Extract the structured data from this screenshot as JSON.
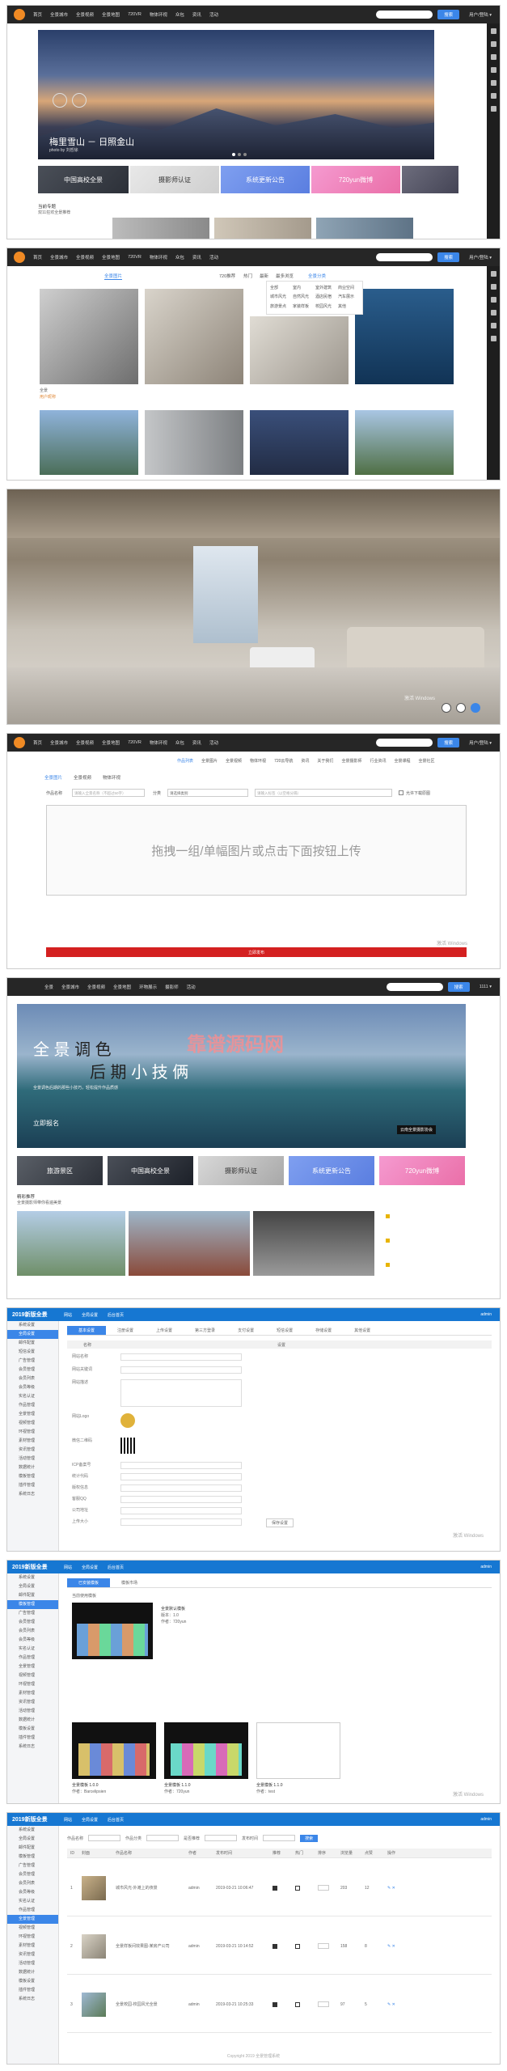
{
  "brand": {
    "accent": "#3b86e8",
    "logo_color": "#f08a24",
    "admin_blue": "#1677d2",
    "submit_red": "#d42020"
  },
  "nav": {
    "items": [
      "首页",
      "全景城市",
      "全景视频",
      "全景地图",
      "720VR",
      "物体环视",
      "众包",
      "资讯",
      "活动"
    ],
    "search_button": "搜索",
    "user": "用户/登陆 ▾"
  },
  "hero": {
    "title": "梅里雪山 － 日照金山",
    "credit": "photo by 刘哲徐",
    "tiles": [
      "中国高校全景",
      "摄影师认证",
      "系统更新公告",
      "720yun微博"
    ],
    "caption_title": "当前专题",
    "caption_sub": "双11狂欢全景推荐"
  },
  "gallery": {
    "tab_selected": "全景图片",
    "menu_title": "全景分类",
    "filters": [
      "720推荐",
      "热门",
      "最新",
      "最多浏览"
    ],
    "menu_items": [
      "全部",
      "室内",
      "室外建筑",
      "商业空间",
      "城市风光",
      "自然风光",
      "酒店民宿",
      "汽车展示",
      "旅游景点",
      "家装样板",
      "校园风光",
      "其他"
    ],
    "item1_label": "全景",
    "item1_author": "用户昵称"
  },
  "upload": {
    "tabs": [
      "全景图片",
      "全景视频",
      "物体环视"
    ],
    "top_tabs": [
      "作品列表",
      "全景图片",
      "全景视频",
      "物体环视",
      "720云导航",
      "资讯",
      "关于我们",
      "全景摄影师",
      "行业资讯",
      "全景课程",
      "全景社区"
    ],
    "label_title": "作品名称",
    "title_placeholder": "请输入全景名称（不超过50字）",
    "label_category": "分类",
    "category_value": "请选择类别",
    "tag_placeholder": "请输入标签（以空格分隔）",
    "checkbox_label": "允许下载原图",
    "drop_text": "拖拽一组/单幅图片或点击下面按钮上传",
    "submit": "立即发布",
    "watermark": "激活 Windows"
  },
  "portal": {
    "nav": [
      "全景",
      "全景城市",
      "全景视频",
      "全景地图",
      "环物展示",
      "摄影师",
      "活动"
    ],
    "search_button": "搜索",
    "user": "1111 ▾",
    "banner_line1_a": "全 景",
    "banner_line1_b": "调 色",
    "banner_line2_a": "后 期",
    "banner_line2_b": "小 技 俩",
    "banner_sub": "全景调色后期的那些小技巧，轻松提升作品质感",
    "banner_watermark": "靠谱源码网",
    "banner_register": "立即报名",
    "banner_brand": "云南全景摄影协会",
    "tiles": [
      "旅游景区",
      "中国高校全景",
      "摄影师认证",
      "系统更新公告",
      "720yun微博"
    ],
    "section_title": "精彩推荐",
    "section_sub": "全景摄影师带你看遍美景"
  },
  "admin1": {
    "title": "2019新版全景",
    "header_links": [
      "网站",
      "全局设置",
      "后台首页"
    ],
    "user": "admin",
    "sidebar": [
      "系统设置",
      "全局设置",
      "邮件配置",
      "短信设置",
      "广告管理",
      "会员管理",
      "会员列表",
      "会员等级",
      "实名认证",
      "作品管理",
      "全景管理",
      "视频管理",
      "环视管理",
      "素材管理",
      "资讯管理",
      "活动管理",
      "数据统计",
      "模板管理",
      "插件管理",
      "系统日志"
    ],
    "active_index": 1,
    "tabs": [
      "基本设置",
      "注册设置",
      "上传设置",
      "第三方登录",
      "支付设置",
      "短信设置",
      "存储设置",
      "其他设置"
    ],
    "form_header_name": "名称",
    "form_header_value": "设置",
    "fields": [
      "网站名称",
      "网站关键词",
      "网站描述",
      "网站Logo",
      "微信二维码",
      "ICP备案号",
      "统计代码",
      "版权信息",
      "客服QQ",
      "公司地址",
      "上传大小",
      "保存设置"
    ],
    "save_button": "保存设置",
    "watermark": "激活 Windows"
  },
  "admin2": {
    "title": "2019新版全景",
    "header_links": [
      "网站",
      "全局设置",
      "后台首页"
    ],
    "user": "admin",
    "sidebar": [
      "系统设置",
      "全局设置",
      "邮件配置",
      "模板管理",
      "广告管理",
      "会员管理",
      "会员列表",
      "会员等级",
      "实名认证",
      "作品管理",
      "全景管理",
      "视频管理",
      "环视管理",
      "素材管理",
      "资讯管理",
      "活动管理",
      "数据统计",
      "模板设置",
      "插件管理",
      "系统日志"
    ],
    "active_index": 3,
    "tabs": [
      "已安装模板",
      "模板市场"
    ],
    "current_label": "当前使用模板",
    "templates": [
      {
        "name": "全景默认模板",
        "meta": "版本：1.0",
        "extra": "作者：720yun"
      },
      {
        "name": "全景模板 1.0.0",
        "meta": "作者：Barcelipsien"
      },
      {
        "name": "全景模板 1.1.0",
        "meta": "作者：720yun"
      },
      {
        "name": "全景模板 1.1.0",
        "meta": "作者：test"
      }
    ],
    "watermark": "激活 Windows"
  },
  "admin3": {
    "title": "2019新版全景",
    "header_links": [
      "网站",
      "全局设置",
      "后台首页"
    ],
    "user": "admin",
    "sidebar": [
      "系统设置",
      "全局设置",
      "邮件配置",
      "模板管理",
      "广告管理",
      "会员管理",
      "会员列表",
      "会员等级",
      "实名认证",
      "作品管理",
      "全景管理",
      "视频管理",
      "环视管理",
      "素材管理",
      "资讯管理",
      "活动管理",
      "数据统计",
      "模板设置",
      "插件管理",
      "系统日志"
    ],
    "active_index": 10,
    "filter_labels": [
      "作品名称",
      "作品分类",
      "是否推荐",
      "发布时间"
    ],
    "search_button": "搜索",
    "columns": [
      "ID",
      "封面",
      "作品名称",
      "作者",
      "发布时间",
      "推荐",
      "热门",
      "排序",
      "浏览量",
      "点赞",
      "操作"
    ],
    "rows": [
      {
        "id": "1",
        "name": "城市风光-外滩上的夜景",
        "author": "admin",
        "date": "2019-03-21 10:06:47",
        "views": "203",
        "likes": "12"
      },
      {
        "id": "2",
        "name": "全景样板间效果图-某房产公司",
        "author": "admin",
        "date": "2019-03-21 10:14:52",
        "views": "158",
        "likes": "8"
      },
      {
        "id": "3",
        "name": "全景校园-校园风光全景",
        "author": "admin",
        "date": "2019-03-21 10:25:33",
        "views": "97",
        "likes": "5"
      }
    ],
    "footer": "Copyright 2019 全景管理系统"
  }
}
